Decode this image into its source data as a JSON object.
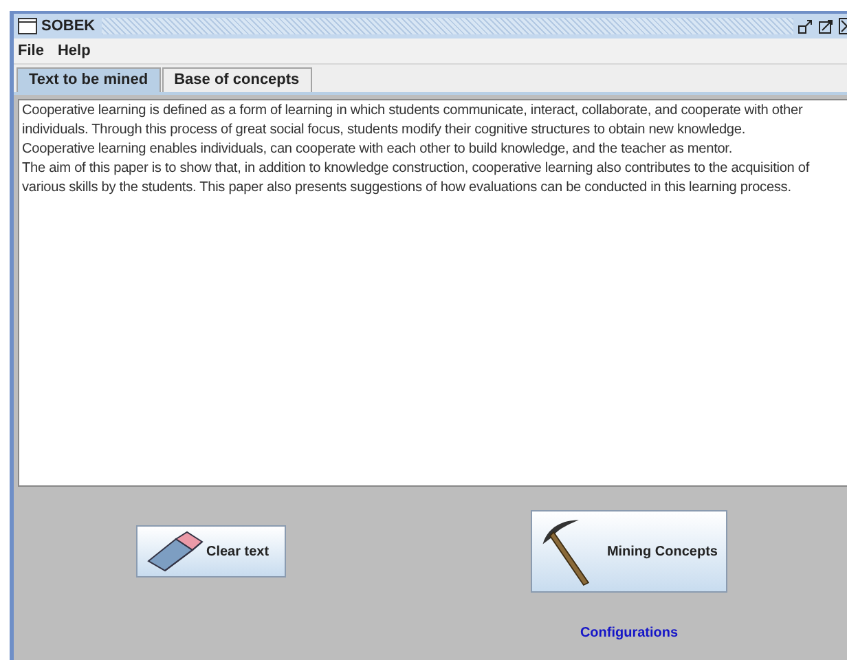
{
  "window": {
    "title": "SOBEK"
  },
  "menu": [
    "File",
    "Help"
  ],
  "tabs": [
    {
      "label": "Text to be mined",
      "selected": true
    },
    {
      "label": "Base of concepts",
      "selected": false
    }
  ],
  "text_area": {
    "paragraphs": [
      "Cooperative learning is defined as a form of learning in which students communicate, interact, collaborate, and cooperate with other individuals. Through this process of great social focus, students modify their cognitive structures to obtain new knowledge.",
      "Cooperative learning enables individuals, can cooperate with each other to build knowledge, and the teacher as mentor.",
      "The aim of this paper is to show that, in addition to knowledge construction, cooperative learning also contributes to the acquisition of various skills by the students. This paper also presents suggestions of how evaluations can be conducted in this learning process."
    ]
  },
  "buttons": {
    "clear": "Clear text",
    "mining": "Mining Concepts"
  },
  "link": "Configurations"
}
